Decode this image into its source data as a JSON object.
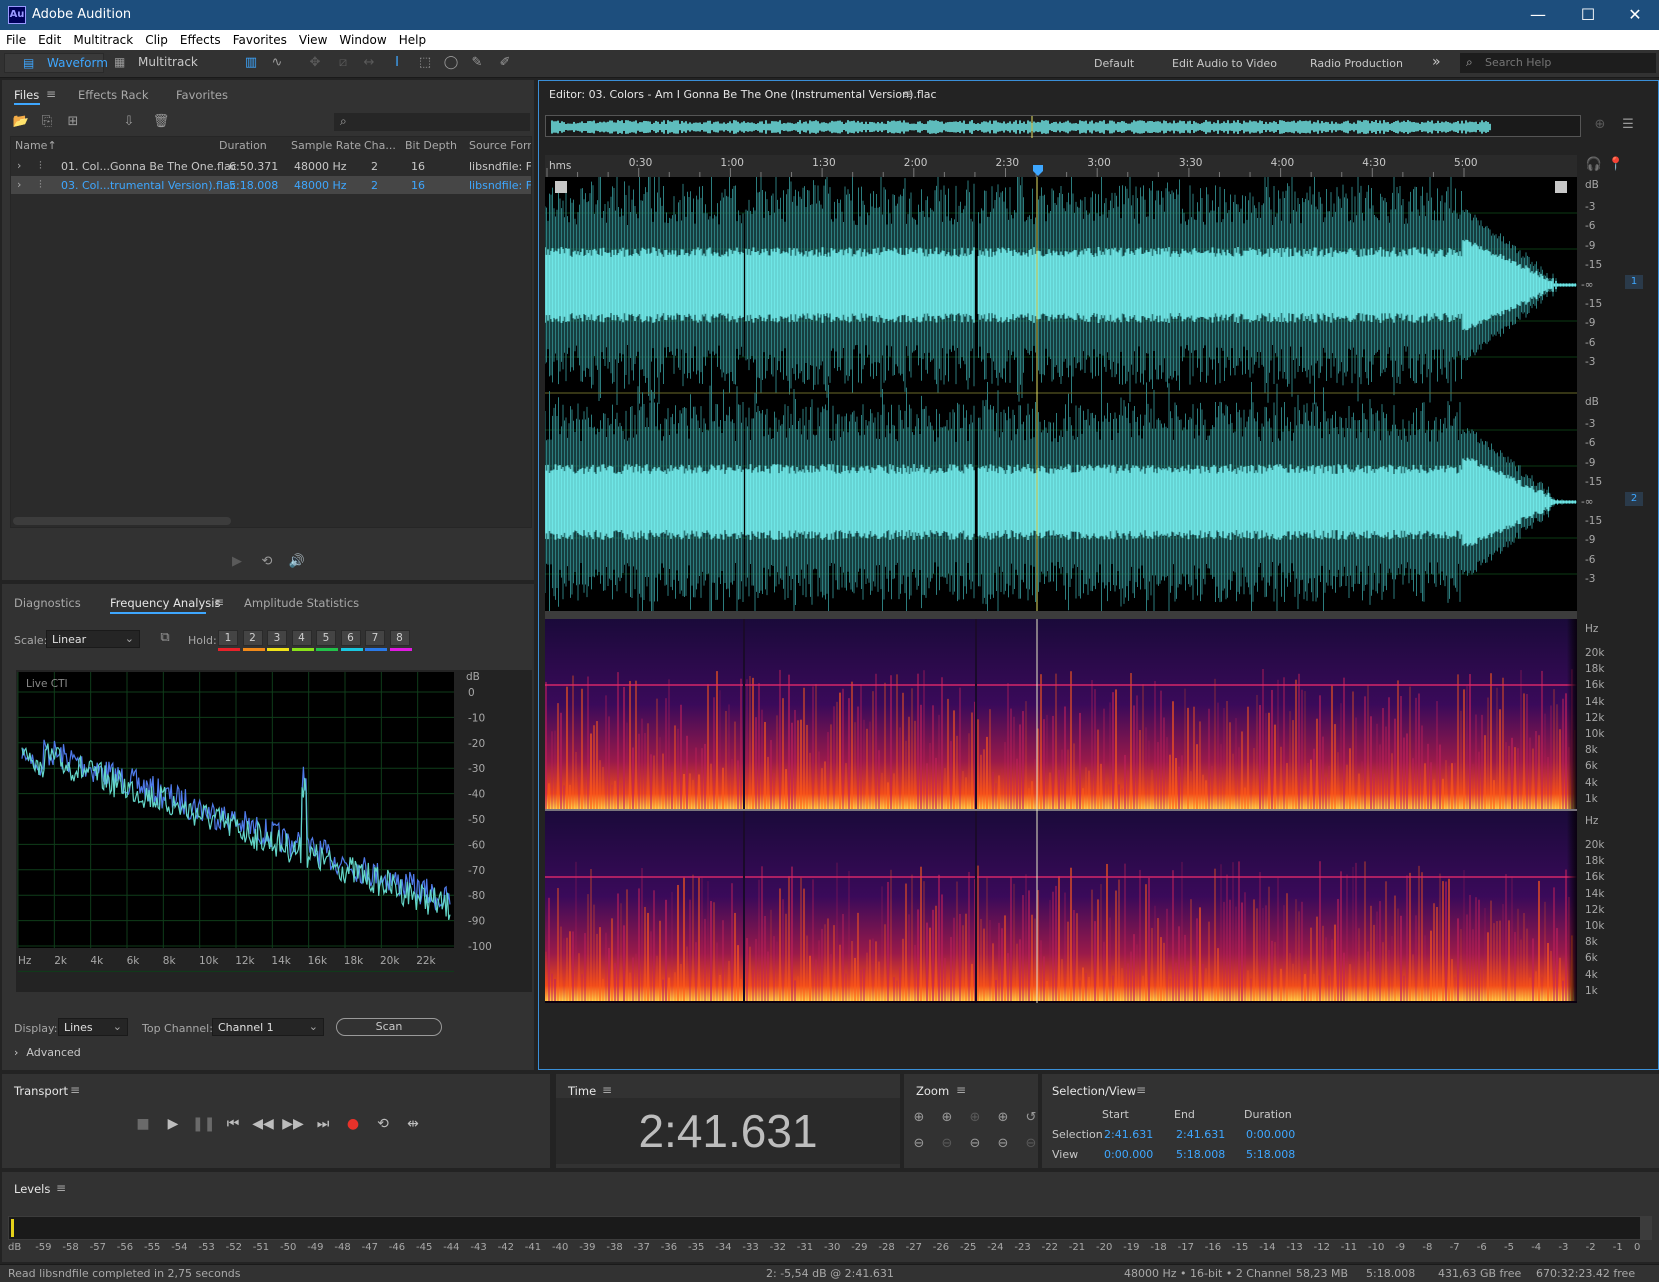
{
  "app": {
    "title": "Adobe Audition",
    "logo": "Au",
    "window_controls": [
      "—",
      "☐",
      "✕"
    ]
  },
  "menu": [
    "File",
    "Edit",
    "Multitrack",
    "Clip",
    "Effects",
    "Favorites",
    "View",
    "Window",
    "Help"
  ],
  "toolbar": {
    "waveform_label": "Waveform",
    "multitrack_label": "Multitrack",
    "workspaces": [
      "Default",
      "Edit Audio to Video",
      "Radio Production"
    ],
    "more": "»",
    "search_placeholder": "Search Help"
  },
  "files_panel": {
    "tabs": [
      "Files",
      "Effects Rack",
      "Favorites"
    ],
    "columns": [
      "Name",
      "Duration",
      "Sample Rate",
      "Cha...",
      "Bit Depth",
      "Source Form..."
    ],
    "sort_arrow": "↑",
    "rows": [
      {
        "name": "01. Col...Gonna Be The One.flac",
        "duration": "6:50.371",
        "sample_rate": "48000 Hz",
        "channels": "2",
        "bit_depth": "16",
        "source": "libsndfile: FL"
      },
      {
        "name": "03. Col...trumental Version).flac",
        "duration": "5:18.008",
        "sample_rate": "48000 Hz",
        "channels": "2",
        "bit_depth": "16",
        "source": "libsndfile: FL"
      }
    ]
  },
  "freq_panel": {
    "tabs": [
      "Diagnostics",
      "Frequency Analysis",
      "Amplitude Statistics"
    ],
    "scale_label": "Scale:",
    "scale_value": "Linear",
    "hold_label": "Hold:",
    "hold_buttons": [
      "1",
      "2",
      "3",
      "4",
      "5",
      "6",
      "7",
      "8"
    ],
    "hold_colors": [
      "#e8222a",
      "#f28a1a",
      "#f0e31a",
      "#8ae21a",
      "#22c24a",
      "#1ac8e0",
      "#2a7ae8",
      "#e01ae0"
    ],
    "graph_label": "Live CTI",
    "db_unit": "dB",
    "db_ticks": [
      "0",
      "-10",
      "-20",
      "-30",
      "-40",
      "-50",
      "-60",
      "-70",
      "-80",
      "-90",
      "-100"
    ],
    "hz_ticks": [
      "Hz",
      "2k",
      "4k",
      "6k",
      "8k",
      "10k",
      "12k",
      "14k",
      "16k",
      "18k",
      "20k",
      "22k"
    ],
    "display_label": "Display:",
    "display_value": "Lines",
    "top_channel_label": "Top Channel:",
    "top_channel_value": "Channel 1",
    "scan_label": "Scan",
    "advanced_label": "Advanced"
  },
  "editor": {
    "title": "Editor: 03. Colors - Am I Gonna Be The One (Instrumental Version).flac",
    "ruler_unit": "hms",
    "ruler_ticks": [
      "0:30",
      "1:00",
      "1:30",
      "2:00",
      "2:30",
      "3:00",
      "3:30",
      "4:00",
      "4:30",
      "5:00"
    ],
    "db_unit": "dB",
    "db_scale": [
      "-3",
      "-6",
      "-9",
      "-15",
      "-∞",
      "-15",
      "-9",
      "-6",
      "-3"
    ],
    "channel_badges": [
      "1",
      "2"
    ],
    "hz_unit": "Hz",
    "hz_scale": [
      "20k",
      "18k",
      "16k",
      "14k",
      "12k",
      "10k",
      "8k",
      "6k",
      "4k",
      "1k"
    ]
  },
  "transport": {
    "title": "Transport",
    "buttons": [
      "stop",
      "play",
      "pause",
      "go-to-start",
      "rewind",
      "fast-forward",
      "go-to-end",
      "record",
      "loop",
      "skip-selection"
    ]
  },
  "time_panel": {
    "title": "Time",
    "value": "2:41.631"
  },
  "zoom_panel": {
    "title": "Zoom"
  },
  "selection_panel": {
    "title": "Selection/View",
    "headers": [
      "Start",
      "End",
      "Duration"
    ],
    "selection_label": "Selection",
    "selection": [
      "2:41.631",
      "2:41.631",
      "0:00.000"
    ],
    "view_label": "View",
    "view": [
      "0:00.000",
      "5:18.008",
      "5:18.008"
    ]
  },
  "levels": {
    "title": "Levels",
    "ticks": [
      "dB",
      "-59",
      "-58",
      "-57",
      "-56",
      "-55",
      "-54",
      "-53",
      "-52",
      "-51",
      "-50",
      "-49",
      "-48",
      "-47",
      "-46",
      "-45",
      "-44",
      "-43",
      "-42",
      "-41",
      "-40",
      "-39",
      "-38",
      "-37",
      "-36",
      "-35",
      "-34",
      "-33",
      "-32",
      "-31",
      "-30",
      "-29",
      "-28",
      "-27",
      "-26",
      "-25",
      "-24",
      "-23",
      "-22",
      "-21",
      "-20",
      "-19",
      "-18",
      "-17",
      "-16",
      "-15",
      "-14",
      "-13",
      "-12",
      "-11",
      "-10",
      "-9",
      "-8",
      "-7",
      "-6",
      "-5",
      "-4",
      "-3",
      "-2",
      "-1",
      "0"
    ]
  },
  "status": {
    "left": "Read libsndfile completed in 2,75 seconds",
    "cursor": "2: -5,54 dB @ 2:41.631",
    "format": "48000 Hz • 16-bit • 2 Channel",
    "size": "58,23 MB",
    "duration": "5:18.008",
    "free": "431,63 GB free",
    "free_time": "670:32:23.42 free"
  },
  "colors": {
    "waveform": "#6fe6e6",
    "accent": "#3ea7ff",
    "record": "#e8322a",
    "playhead": "#e6e266"
  }
}
